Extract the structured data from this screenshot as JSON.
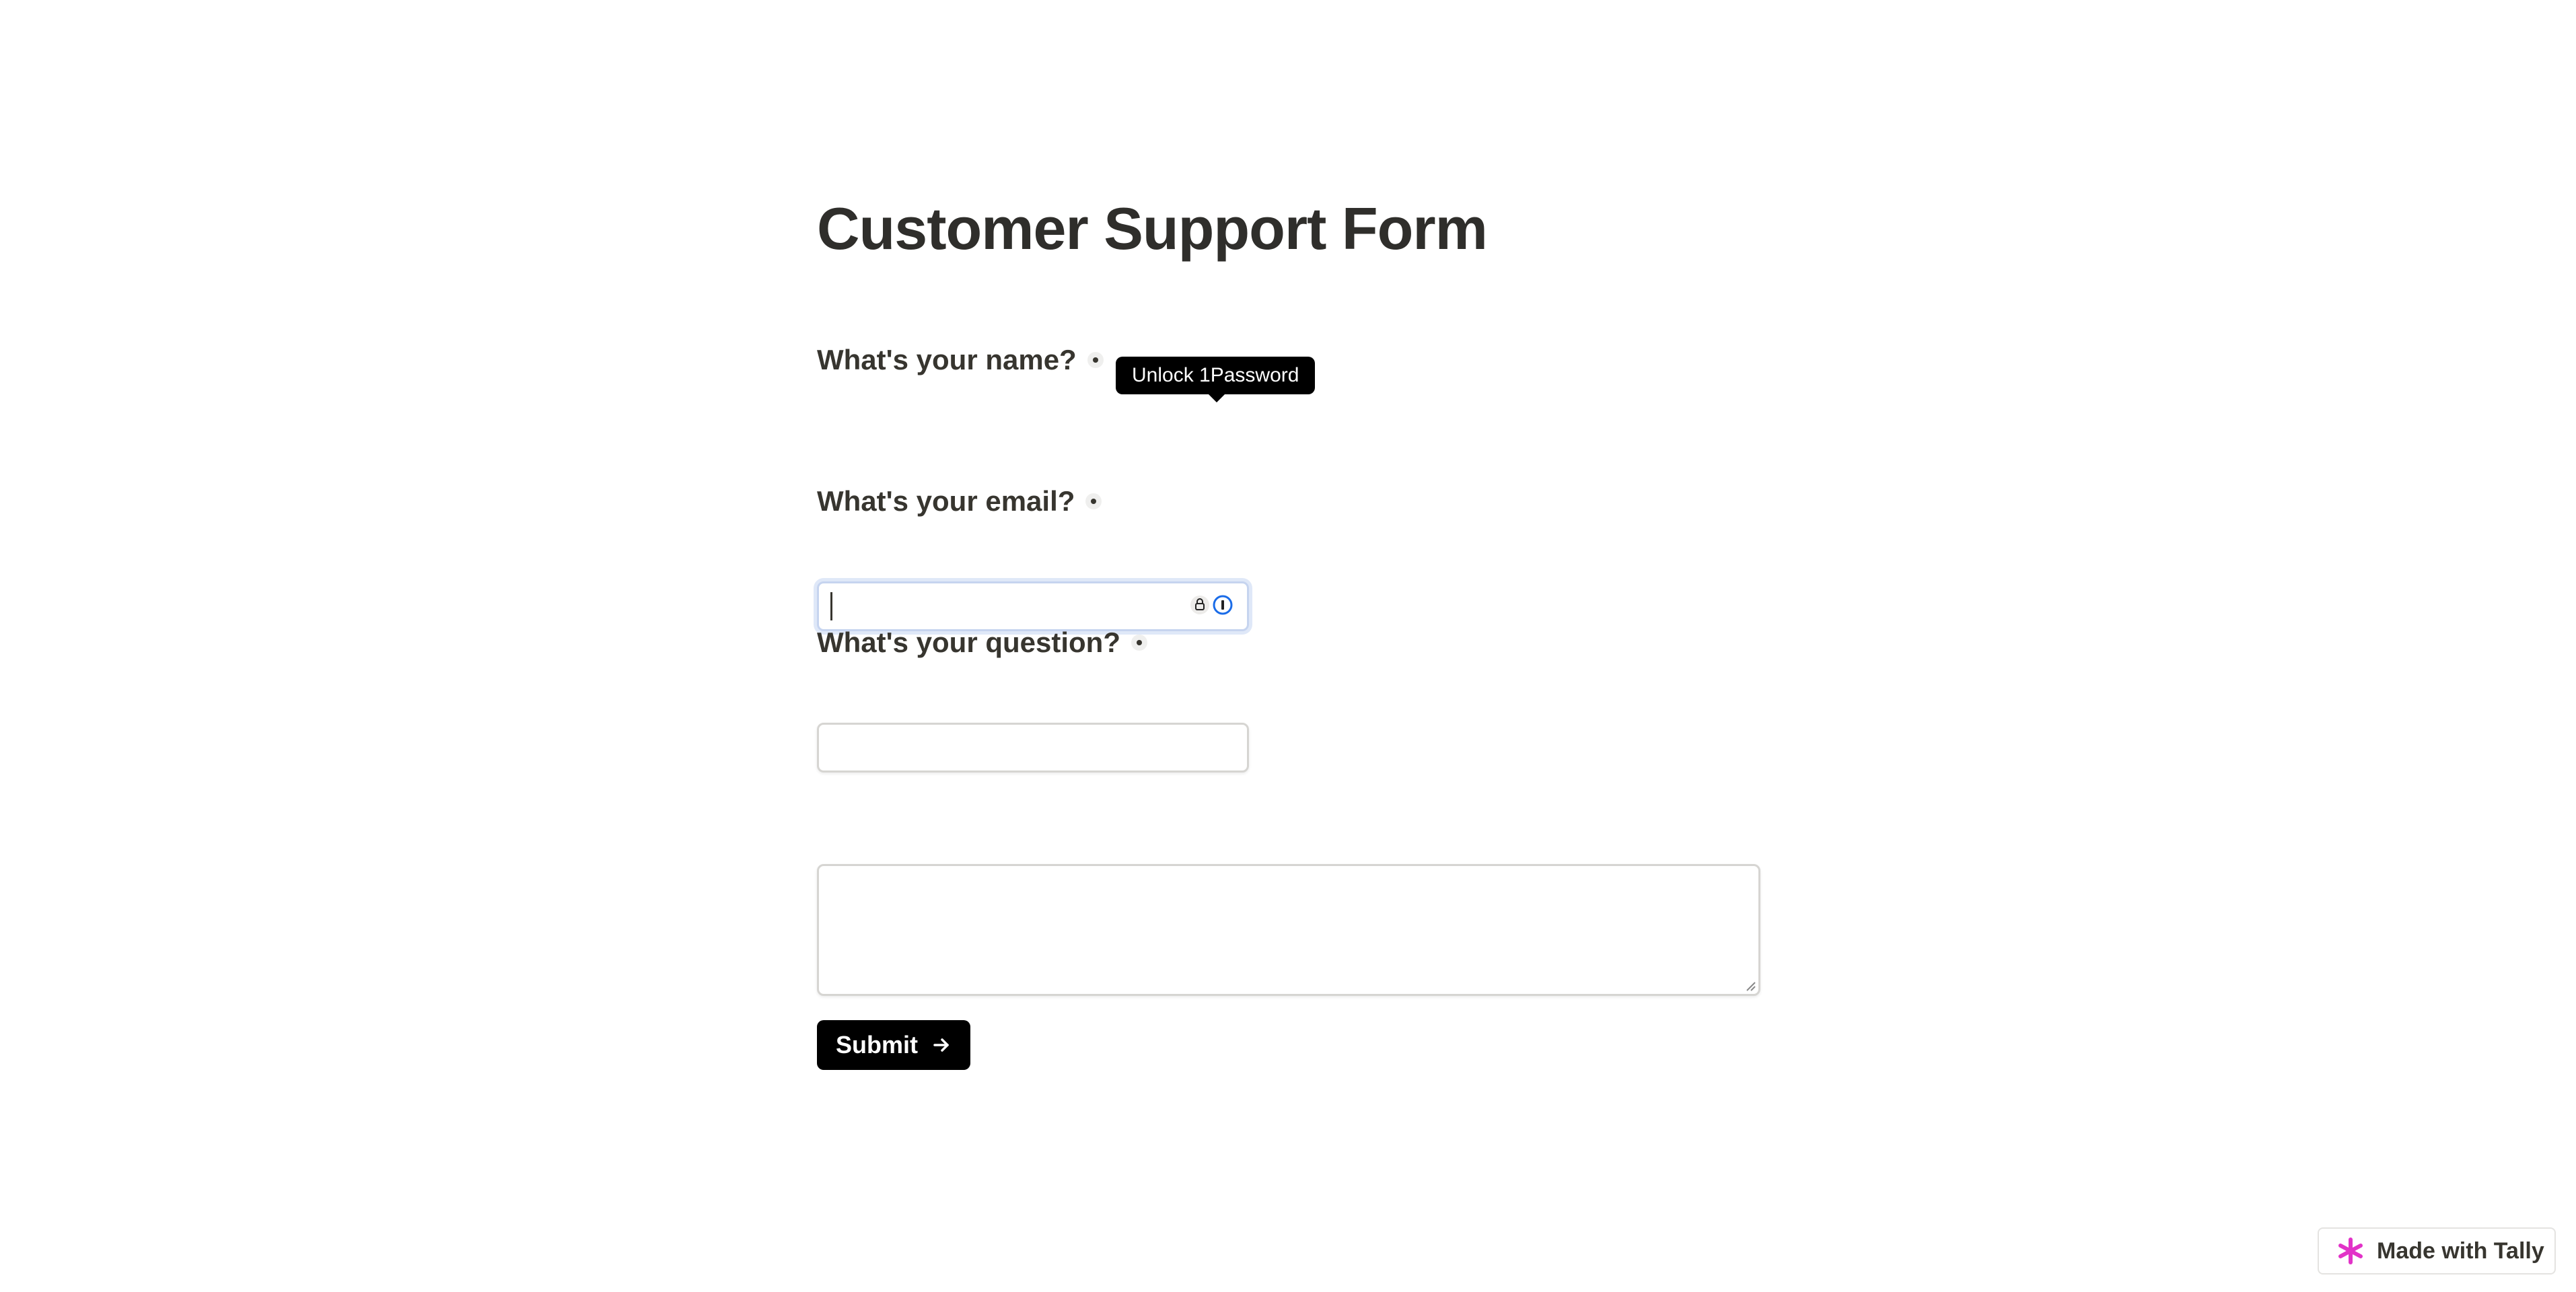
{
  "form": {
    "title": "Customer Support Form",
    "questions": [
      {
        "label": "What's your name?",
        "required": true,
        "value": ""
      },
      {
        "label": "What's your email?",
        "required": true,
        "value": ""
      },
      {
        "label": "What's your question?",
        "required": true,
        "value": ""
      }
    ],
    "submit_label": "Submit"
  },
  "password_manager": {
    "tooltip": "Unlock 1Password",
    "icons": [
      "lock-icon",
      "1password-icon"
    ]
  },
  "badge": {
    "label": "Made with Tally",
    "icon": "tally-asterisk-icon",
    "icon_color": "#e233c8"
  }
}
